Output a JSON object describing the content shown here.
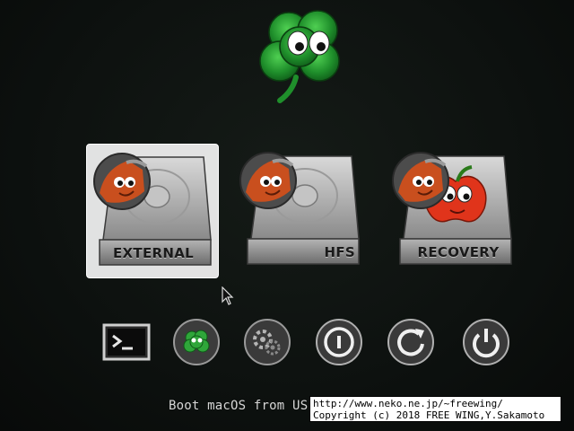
{
  "theme": {
    "accent": "#2e9b3c",
    "background": "#0d110f",
    "selection": "#ffffff"
  },
  "logo": {
    "icon": "clover-eyes-icon"
  },
  "boot_entries": [
    {
      "label": "EXTERNAL",
      "volume_icon": "ext-volume-badge-icon",
      "selected": true
    },
    {
      "label": "HFS",
      "volume_icon": "hfs-volume-badge-icon",
      "selected": false
    },
    {
      "label": "RECOVERY",
      "volume_icon": "recovery-apple-badge-icon",
      "selected": false
    }
  ],
  "tools": [
    {
      "name": "shell",
      "icon": "terminal-prompt-icon"
    },
    {
      "name": "clover-options",
      "icon": "clover-icon"
    },
    {
      "name": "options",
      "icon": "gear-icon"
    },
    {
      "name": "about",
      "icon": "info-icon"
    },
    {
      "name": "restart",
      "icon": "restart-icon"
    },
    {
      "name": "shutdown",
      "icon": "power-icon"
    }
  ],
  "status": {
    "text": "Boot macOS from US"
  },
  "watermark": {
    "line1": "http://www.neko.ne.jp/~freewing/",
    "line2": "Copyright (c) 2018 FREE WING,Y.Sakamoto"
  }
}
